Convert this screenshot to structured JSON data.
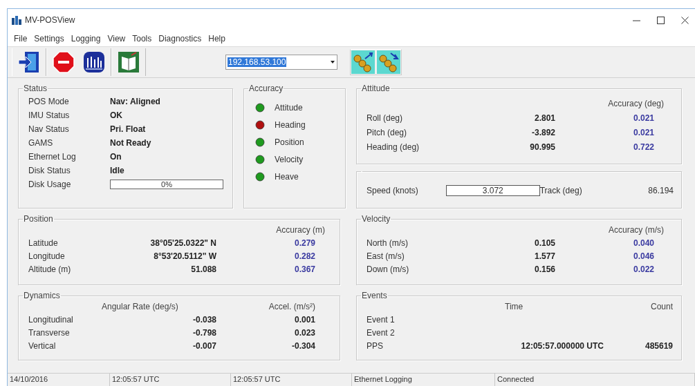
{
  "window": {
    "title": "MV-POSView"
  },
  "menu": [
    "File",
    "Settings",
    "Logging",
    "View",
    "Tools",
    "Diagnostics",
    "Help"
  ],
  "toolbar": {
    "address": "192.168.53.100"
  },
  "status": {
    "title": "Status",
    "rows": [
      {
        "label": "POS Mode",
        "value": "Nav: Aligned"
      },
      {
        "label": "IMU Status",
        "value": "OK"
      },
      {
        "label": "Nav Status",
        "value": "Pri. Float"
      },
      {
        "label": "GAMS",
        "value": "Not Ready"
      },
      {
        "label": "Ethernet Log",
        "value": "On"
      },
      {
        "label": "Disk Status",
        "value": "Idle"
      }
    ],
    "disk_usage": {
      "label": "Disk Usage",
      "level": 0,
      "reading": "0%"
    }
  },
  "accuracy": {
    "title": "Accuracy",
    "indicators": [
      {
        "label": "Attitude",
        "color": "#1f9a1f"
      },
      {
        "label": "Heading",
        "color": "#b01010"
      },
      {
        "label": "Position",
        "color": "#1f9a1f"
      },
      {
        "label": "Velocity",
        "color": "#1f9a1f"
      },
      {
        "label": "Heave",
        "color": "#1f9a1f"
      }
    ]
  },
  "attitude": {
    "title": "Attitude",
    "accuracy_header": "Accuracy (deg)",
    "rows": [
      {
        "label": "Roll (deg)",
        "value": "2.801",
        "accuracy": "0.021"
      },
      {
        "label": "Pitch (deg)",
        "value": "-3.892",
        "accuracy": "0.021"
      },
      {
        "label": "Heading (deg)",
        "value": "90.995",
        "accuracy": "0.722"
      }
    ]
  },
  "speed": {
    "label": "Speed (knots)",
    "value": "3.072",
    "track_label": "Track (deg)",
    "track_value": "86.194"
  },
  "position": {
    "title": "Position",
    "accuracy_header": "Accuracy (m)",
    "rows": [
      {
        "label": "Latitude",
        "value": "38°05'25.0322\" N",
        "accuracy": "0.279"
      },
      {
        "label": "Longitude",
        "value": "8°53'20.5112\" W",
        "accuracy": "0.282"
      },
      {
        "label": "Altitude (m)",
        "value": "51.088",
        "accuracy": "0.367"
      }
    ]
  },
  "velocity": {
    "title": "Velocity",
    "accuracy_header": "Accuracy (m/s)",
    "rows": [
      {
        "label": "North (m/s)",
        "value": "0.105",
        "accuracy": "0.040"
      },
      {
        "label": "East  (m/s)",
        "value": "1.577",
        "accuracy": "0.046"
      },
      {
        "label": "Down (m/s)",
        "value": "0.156",
        "accuracy": "0.022"
      }
    ]
  },
  "dynamics": {
    "title": "Dynamics",
    "headers": [
      "Angular Rate (deg/s)",
      "Accel. (m/s²)"
    ],
    "rows": [
      {
        "label": "Longitudinal",
        "angular_rate": "-0.038",
        "accel": "0.001"
      },
      {
        "label": "Transverse",
        "angular_rate": "-0.798",
        "accel": "0.023"
      },
      {
        "label": "Vertical",
        "angular_rate": "-0.007",
        "accel": "-0.304"
      }
    ]
  },
  "events": {
    "title": "Events",
    "headers": [
      "Time",
      "Count"
    ],
    "rows": [
      {
        "label": "Event 1"
      },
      {
        "label": "Event 2"
      },
      {
        "label": "PPS",
        "time": "12:05:57.000000 UTC",
        "count": "485619"
      }
    ]
  },
  "status_bar": [
    "14/10/2016",
    "12:05:57 UTC",
    "12:05:57 UTC",
    "Ethernet Logging",
    "Connected"
  ]
}
